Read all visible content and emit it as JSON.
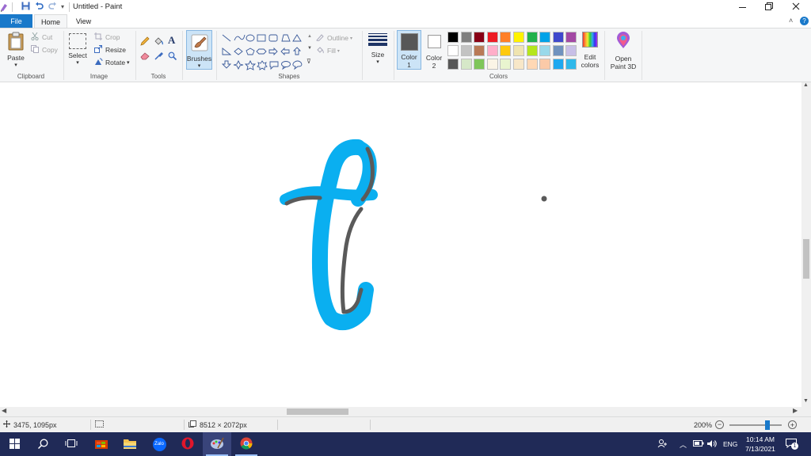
{
  "window": {
    "title": "Untitled - Paint",
    "minimize_icon": "minimize-icon",
    "restore_icon": "restore-icon",
    "close_icon": "close-icon"
  },
  "tabs": {
    "file": "File",
    "home": "Home",
    "view": "View"
  },
  "ribbon": {
    "clipboard": {
      "label": "Clipboard",
      "paste": "Paste",
      "cut": "Cut",
      "copy": "Copy"
    },
    "image": {
      "label": "Image",
      "select": "Select",
      "crop": "Crop",
      "resize": "Resize",
      "rotate": "Rotate"
    },
    "tools": {
      "label": "Tools"
    },
    "brushes": {
      "label": "Brushes"
    },
    "shapes": {
      "label": "Shapes",
      "outline": "Outline",
      "fill": "Fill"
    },
    "size": {
      "label": "Size"
    },
    "colors": {
      "label": "Colors",
      "color1": "Color",
      "color1_num": "1",
      "color2": "Color",
      "color2_num": "2",
      "edit_colors_1": "Edit",
      "edit_colors_2": "colors",
      "paint3d_1": "Open",
      "paint3d_2": "Paint 3D",
      "color1_value": "#575757",
      "color2_value": "#ffffff",
      "palette_row1": [
        "#000000",
        "#7f7f7f",
        "#880015",
        "#ed1c24",
        "#ff7f27",
        "#fff200",
        "#22b14c",
        "#00a2e8",
        "#3f48cc",
        "#a349a4"
      ],
      "palette_row2": [
        "#ffffff",
        "#c3c3c3",
        "#b97a57",
        "#ffaec9",
        "#ffc90e",
        "#efe4b0",
        "#b5e61d",
        "#99d9ea",
        "#7092be",
        "#c8bfe7"
      ],
      "palette_row3": [
        "#575757",
        "#d6e8c8",
        "#7fc65a",
        "#fbf4e6",
        "#e9f5cf",
        "#f8e7c8",
        "#ffd8b5",
        "#fbcaa8",
        "#1ea8f0",
        "#2fb8ea"
      ]
    }
  },
  "status": {
    "cursor_pos": "3475, 1095px",
    "canvas_size": "8512 × 2072px",
    "zoom": "200%",
    "zoom_level": 0.72
  },
  "taskbar": {
    "time": "10:14 AM",
    "date": "7/13/2021",
    "lang": "ENG",
    "notification_count": "1",
    "zalo_label": "Zalo"
  },
  "drawing": {
    "stroke_blue": "#0aaff0",
    "stroke_gray": "#5a5a5a"
  }
}
